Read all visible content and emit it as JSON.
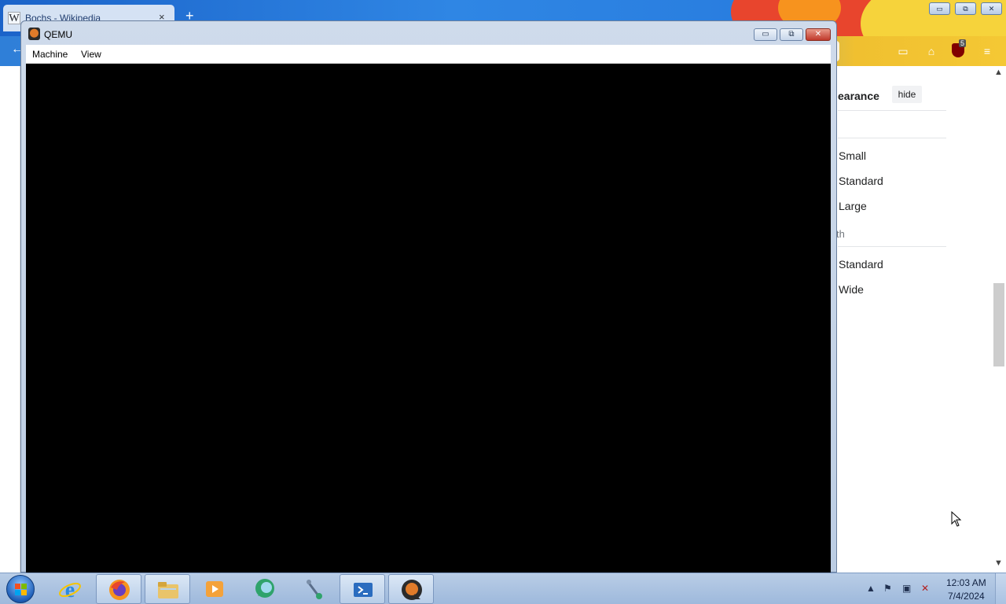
{
  "firefox": {
    "tab_title": "Bochs - Wikipedia",
    "tab_close": "×",
    "new_tab": "+",
    "addon_badge": "5",
    "caption_buttons": {
      "minimize": "▭",
      "restore": "⧉",
      "close": "✕"
    }
  },
  "wikipedia": {
    "appearance_title": "earance",
    "hide_button": "hide",
    "text_options": [
      "Small",
      "Standard",
      "Large"
    ],
    "width_label": "th",
    "width_options": [
      "Standard",
      "Wide"
    ]
  },
  "qemu": {
    "title": "QEMU",
    "menu": [
      "Machine",
      "View"
    ],
    "buttons": {
      "minimize": "▭",
      "restore": "⧉",
      "close": "✕"
    }
  },
  "taskbar": {
    "items": [
      {
        "name": "internet-explorer",
        "active": false
      },
      {
        "name": "firefox",
        "active": true
      },
      {
        "name": "file-explorer",
        "active": true
      },
      {
        "name": "media-player",
        "active": false
      },
      {
        "name": "chat-app",
        "active": false
      },
      {
        "name": "network-tool",
        "active": false
      },
      {
        "name": "powershell",
        "active": true
      },
      {
        "name": "qemu",
        "active": true
      }
    ],
    "clock_time": "12:03 AM",
    "clock_date": "7/4/2024"
  },
  "colors": {
    "taskbar": "#b9cde6",
    "qemu_screen": "#000000",
    "accent_blue": "#2f86e4"
  }
}
